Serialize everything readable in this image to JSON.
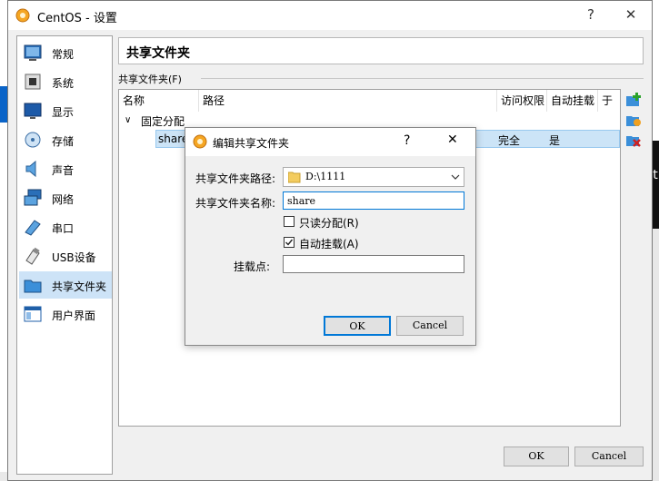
{
  "window": {
    "title": "CentOS - 设置",
    "help": "?",
    "close": "✕"
  },
  "sidebar": {
    "items": [
      {
        "label": "常规",
        "icon": "general-icon"
      },
      {
        "label": "系统",
        "icon": "system-chip-icon"
      },
      {
        "label": "显示",
        "icon": "display-monitor-icon"
      },
      {
        "label": "存储",
        "icon": "storage-disk-icon"
      },
      {
        "label": "声音",
        "icon": "audio-speaker-icon"
      },
      {
        "label": "网络",
        "icon": "network-icon"
      },
      {
        "label": "串口",
        "icon": "serial-port-icon"
      },
      {
        "label": "USB设备",
        "icon": "usb-icon"
      },
      {
        "label": "共享文件夹",
        "icon": "shared-folder-icon",
        "active": true
      },
      {
        "label": "用户界面",
        "icon": "user-interface-icon"
      }
    ]
  },
  "page": {
    "title": "共享文件夹",
    "group_label": "共享文件夹(F)",
    "table": {
      "headers": [
        "名称",
        "路径",
        "访问权限",
        "自动挂载",
        "于"
      ],
      "group": {
        "toggle": "∨",
        "label": "固定分配"
      },
      "row": {
        "name": "share",
        "access": "完全",
        "automount": "是"
      }
    }
  },
  "footer": {
    "ok": "OK",
    "cancel": "Cancel"
  },
  "dialog": {
    "title": "编辑共享文件夹",
    "help": "?",
    "close": "✕",
    "path_label": "共享文件夹路径:",
    "path_value": "D:\\1111",
    "name_label": "共享文件夹名称:",
    "name_value": "share",
    "readonly_label": "只读分配(R)",
    "readonly_checked": false,
    "automount_label": "自动挂载(A)",
    "automount_checked": true,
    "mountpoint_label": "挂载点:",
    "mountpoint_value": "",
    "ok": "OK",
    "cancel": "Cancel"
  },
  "background": {
    "right_edge_text": "t"
  }
}
